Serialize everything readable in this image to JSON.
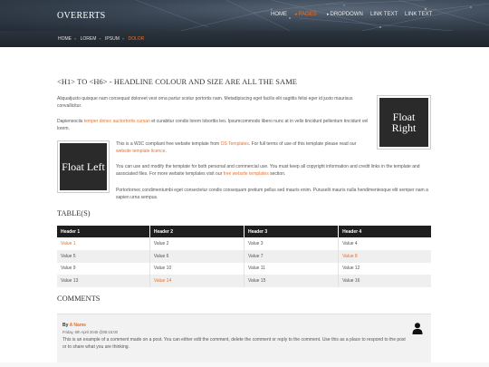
{
  "site": {
    "logo": "OVERERTS"
  },
  "nav": [
    {
      "label": "HOME",
      "active": false,
      "bullet": ""
    },
    {
      "label": "PAGES",
      "active": true,
      "bullet": "▸"
    },
    {
      "label": "DROPDOWN",
      "active": false,
      "bullet": "▸"
    },
    {
      "label": "LINK TEXT",
      "active": false,
      "bullet": ""
    },
    {
      "label": "LINK TEXT",
      "active": false,
      "bullet": ""
    }
  ],
  "breadcrumb": {
    "items": [
      "HOME",
      "LOREM",
      "IPSUM"
    ],
    "current": "DOLOR"
  },
  "main": {
    "heading": "<H1> TO <H6> - HEADLINE COLOUR AND SIZE ARE ALL THE SAME",
    "p1": "Aliquatjusto quisque nam consequat doloreet vest orna partur scetur portortis nam. Metadipiscing eget facilis elit sagittis felisi eger id justo maurisus convallicitur.",
    "p2_pre": "Dapiensociis ",
    "p2_link": "temper donec auctortortis cursan",
    "p2_post": " et curabitur condis lorem loborttis leo. Ipsumcommodo libero nunc at in velis tincidunt pellentum tincidunt vel lorem.",
    "float_right": "Float Right",
    "float_left": "Float Left",
    "p3_pre": "This is a W3C compliant free website template from ",
    "p3_link1": "OS Templates",
    "p3_mid": ". For full terms of use of this template please read our ",
    "p3_link2": "website template licence",
    "p3_end": ".",
    "p4_pre": "You can use and modify the template for both personal and commercial use. You must keep all copyright information and credit links in the template and associated files. For more website templates visit our ",
    "p4_link": "free website templates",
    "p4_end": " section.",
    "p5": "Portortornec condimentumbi eget consectetur condis consequam pretium pellus sed mauris enim. Puruselit mauris nulla hendimentesque elit semper nam a sapien urna sempus."
  },
  "tables": {
    "heading": "TABLE(S)",
    "headers": [
      "Header 1",
      "Header 2",
      "Header 3",
      "Header 4"
    ],
    "rows": [
      [
        "Value 1",
        "Value 2",
        "Value 3",
        "Value 4"
      ],
      [
        "Value 5",
        "Value 6",
        "Value 7",
        "Value 8"
      ],
      [
        "Value 9",
        "Value 10",
        "Value 11",
        "Value 12"
      ],
      [
        "Value 13",
        "Value 14",
        "Value 15",
        "Value 16"
      ]
    ],
    "highlighted": [
      "Value 1",
      "Value 8",
      "Value 14"
    ]
  },
  "comments": {
    "heading": "COMMENTS",
    "by_label": "By ",
    "author": "A Name",
    "date": "Friday, 6th April 2045 @08:15:00",
    "text": "This is an example of a comment made on a post. You can either edit the comment, delete the comment or reply to the comment. Use this as a place to respond to the post or to share what you are thinking."
  },
  "colors": {
    "accent": "#e8712e",
    "header_dark": "#1e1e1e"
  }
}
